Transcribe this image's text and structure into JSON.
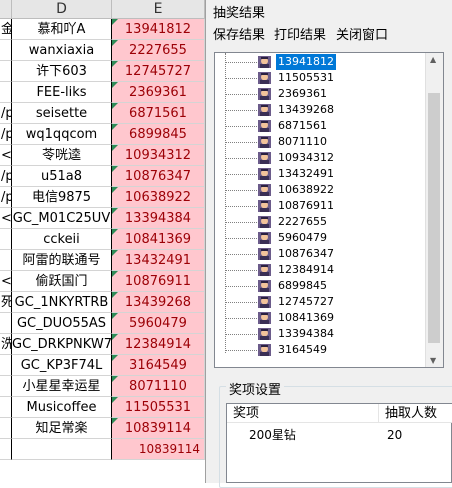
{
  "sheet": {
    "col_d": "D",
    "col_e": "E",
    "rows": [
      {
        "c": "金哈",
        "d": "慕和吖A",
        "e": "13941812"
      },
      {
        "c": "",
        "d": "wanxiaxia",
        "e": "2227655"
      },
      {
        "c": "",
        "d": "许下603",
        "e": "12745727"
      },
      {
        "c": "",
        "d": "FEE-liks",
        "e": "2369361"
      },
      {
        "c": "/p",
        "d": "seisette",
        "e": "6871561"
      },
      {
        "c": "/p",
        "d": "wq1qqcom",
        "e": "6899845"
      },
      {
        "c": "<",
        "d": "苓咣逵",
        "e": "10934312"
      },
      {
        "c": "/p",
        "d": "u51a8",
        "e": "10876347"
      },
      {
        "c": "/p",
        "d": "电信9875",
        "e": "10638922"
      },
      {
        "c": "<",
        "d": "GC_M01C25UV",
        "e": "13394384"
      },
      {
        "c": "",
        "d": "cckeii",
        "e": "10841369"
      },
      {
        "c": "",
        "d": "阿雷的联通号",
        "e": "13432491"
      },
      {
        "c": "<",
        "d": "偷跃国门",
        "e": "10876911"
      },
      {
        "c": "死",
        "d": "GC_1NKYRTRB",
        "e": "13439268"
      },
      {
        "c": "",
        "d": "GC_DUO55AS",
        "e": "5960479"
      },
      {
        "c": "洗",
        "d": "GC_DRKPNKW7",
        "e": "12384914"
      },
      {
        "c": "",
        "d": "GC_KP3F74L",
        "e": "3164549"
      },
      {
        "c": "",
        "d": "小星星幸运星",
        "e": "8071110"
      },
      {
        "c": "",
        "d": "Musicoffee",
        "e": "11505531"
      },
      {
        "c": "",
        "d": "知足常楽",
        "e": "10839114"
      },
      {
        "c": "",
        "d": "",
        "e": "10839114"
      }
    ]
  },
  "dialog": {
    "title": "抽奖结果",
    "menu": [
      "保存结果",
      "打印结果",
      "关闭窗口"
    ],
    "results": [
      "13941812",
      "11505531",
      "2369361",
      "13439268",
      "6871561",
      "8071110",
      "10934312",
      "13432491",
      "10638922",
      "10876911",
      "2227655",
      "5960479",
      "10876347",
      "12384914",
      "6899845",
      "12745727",
      "10841369",
      "13394384",
      "3164549"
    ],
    "selected_index": 0,
    "group_title": "奖项设置",
    "list_headers": [
      "奖项",
      "抽取人数"
    ],
    "list_rows": [
      {
        "prize": "200星钻",
        "count": "20"
      }
    ]
  }
}
